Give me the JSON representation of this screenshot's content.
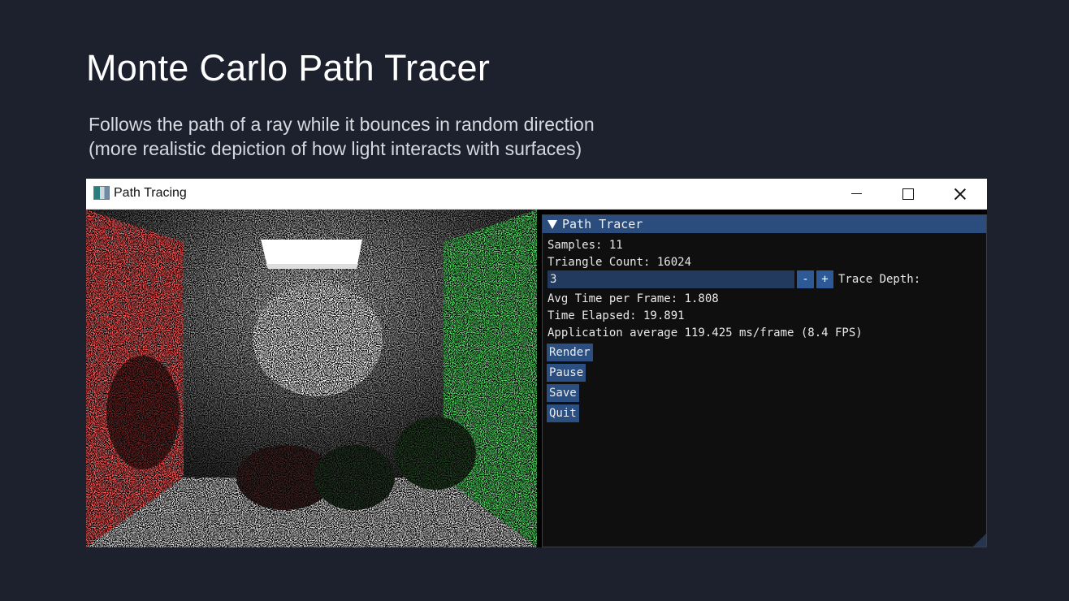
{
  "slide": {
    "title": "Monte Carlo Path Tracer",
    "subtitle_line1": "Follows the path of a ray while it bounces in random direction",
    "subtitle_line2": "(more realistic depiction of how light interacts with surfaces)"
  },
  "window": {
    "title": "Path Tracing",
    "icon": "app-icon",
    "controls": [
      "minimize-icon",
      "maximize-icon",
      "close-icon"
    ]
  },
  "panel": {
    "header": "Path Tracer",
    "samples": "Samples: 11",
    "triangle_count": "Triangle Count: 16024",
    "trace_depth_value": "3",
    "minus": "-",
    "plus": "+",
    "trace_depth_label": "Trace Depth:",
    "avg_time": "Avg Time per Frame: 1.808",
    "time_elapsed": "Time Elapsed: 19.891",
    "app_average": "Application average 119.425 ms/frame (8.4 FPS)",
    "buttons": {
      "render": "Render",
      "pause": "Pause",
      "save": "Save",
      "quit": "Quit"
    }
  },
  "colors": {
    "background": "#1c212d",
    "panel_header": "#2b4d7e",
    "button": "#2b4f80",
    "left_wall": "#e05050",
    "right_wall": "#4fc060"
  }
}
